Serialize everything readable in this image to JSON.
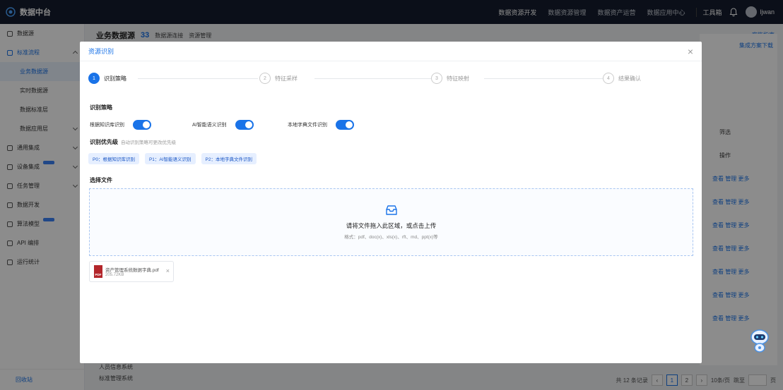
{
  "app": {
    "title": "数据中台"
  },
  "topnav": {
    "items": [
      "数据资源开发",
      "数据资源管理",
      "数据资产运营",
      "数据应用中心"
    ],
    "tools": "工具箱",
    "user": "ljwan"
  },
  "sidebar": {
    "items": [
      {
        "label": "数据源"
      },
      {
        "label": "标准流程"
      },
      {
        "label": "业务数据源"
      },
      {
        "label": "实时数据源"
      },
      {
        "label": "数据标准层"
      },
      {
        "label": "数据应用层"
      },
      {
        "label": "通用集成"
      },
      {
        "label": "设备集成"
      },
      {
        "label": "任务管理"
      },
      {
        "label": "数据开发"
      },
      {
        "label": "算法模型"
      },
      {
        "label": "API 编排"
      },
      {
        "label": "运行统计"
      }
    ],
    "footer": "回收站"
  },
  "main": {
    "title": "业务数据源",
    "count": "33",
    "links": [
      "数据源连接",
      "资源管理"
    ],
    "guide": "实施指南",
    "filter": "筛选",
    "ops_header": "操作",
    "row_ops": "查看 管理 更多",
    "download": "集成方案下载",
    "bottom_items": [
      "人员信息系统",
      "标准管理系统"
    ],
    "pager": {
      "total": "共 12 条记录",
      "pages": [
        "1",
        "2"
      ],
      "size": "10条/页",
      "goto": "跳至",
      "suffix": "页"
    }
  },
  "modal": {
    "title": "资源识别",
    "steps": [
      {
        "num": "1",
        "label": "识别策略"
      },
      {
        "num": "2",
        "label": "特征采样"
      },
      {
        "num": "3",
        "label": "特征映射"
      },
      {
        "num": "4",
        "label": "结果确认"
      }
    ],
    "strategy_title": "识别策略",
    "switches": [
      {
        "label": "根据知识库识别",
        "on": true
      },
      {
        "label": "AI智能语义识别",
        "on": true
      },
      {
        "label": "本地字典文件识别",
        "on": true
      }
    ],
    "priority_title": "识别优先级",
    "priority_hint": "自动识别策略可更改优先级",
    "priorities": [
      "P0：根据知识库识别",
      "P1：AI智能语义识别",
      "P2：本地字典文件识别"
    ],
    "file_title": "选择文件",
    "drop_main": "请将文件拖入此区域，或点击上传",
    "drop_formats": "格式：pdf、doc(x)、xls(x)、rft、md、ppt(x)等",
    "file": {
      "name": "资产管理系统数据字典.pdf",
      "size": "205.72KB",
      "type": "PDF"
    }
  },
  "colors": {
    "accent": "#1a73e8",
    "topbar": "#141d2e",
    "pdf": "#b3262b"
  }
}
